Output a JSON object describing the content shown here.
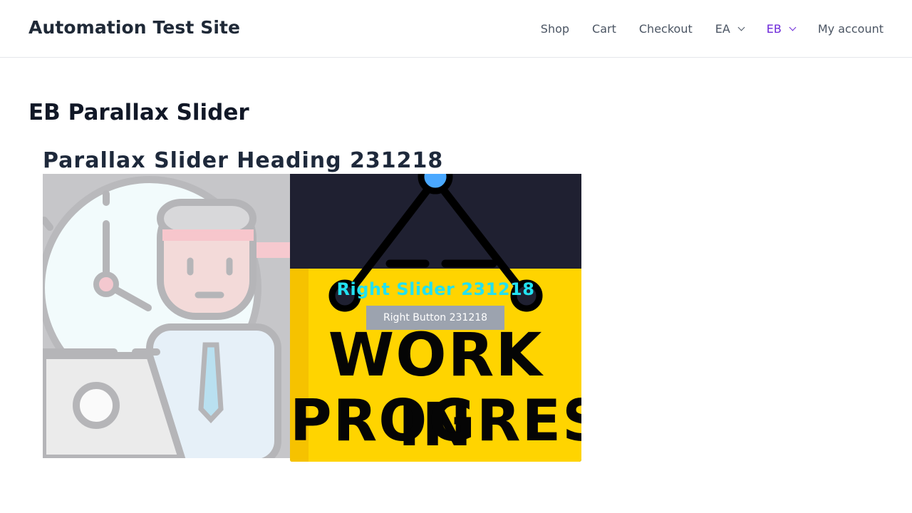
{
  "site": {
    "title": "Automation Test Site"
  },
  "nav": {
    "items": [
      {
        "label": "Shop"
      },
      {
        "label": "Cart"
      },
      {
        "label": "Checkout"
      },
      {
        "label": "EA"
      },
      {
        "label": "EB"
      },
      {
        "label": "My account"
      }
    ],
    "active_color": "#6d28d9"
  },
  "page": {
    "title": "EB Parallax Slider"
  },
  "slider": {
    "heading": "Parallax Slider Heading 231218",
    "right": {
      "title": "Right Slider 231218",
      "button_label": "Right Button 231218",
      "sign_line1": "WORK IN",
      "sign_line2": "PROGRESS",
      "title_color": "#22e1f0",
      "sign_color": "#ffd400"
    }
  }
}
